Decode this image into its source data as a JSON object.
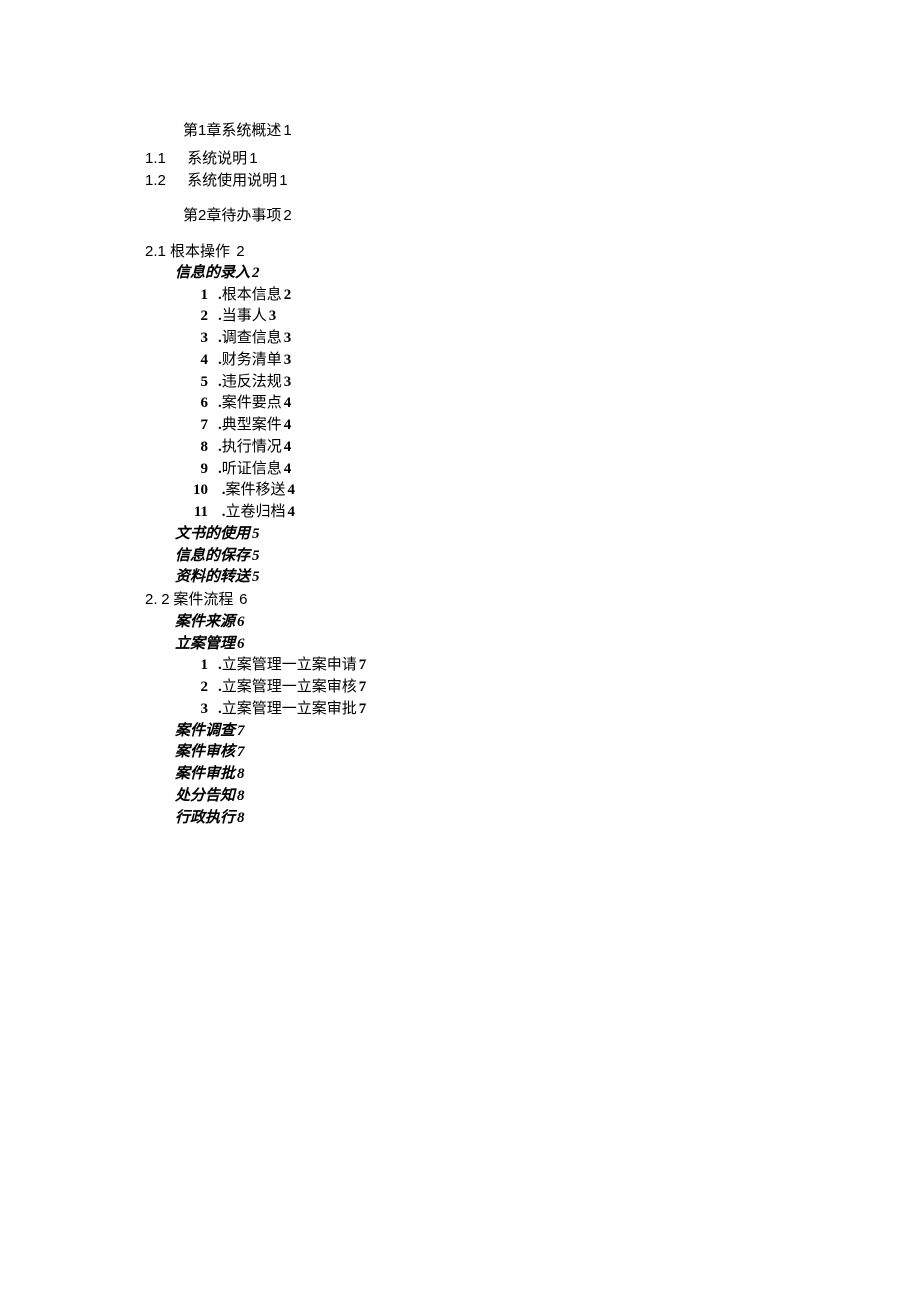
{
  "toc": {
    "ch1": {
      "title_pre": "第",
      "title_num": "1",
      "title_post": "章系统概述",
      "page": "1"
    },
    "s1_1": {
      "num": "1.1",
      "label": "系统说明",
      "page": "1"
    },
    "s1_2": {
      "num": "1.2",
      "label": "系统使用说明",
      "page": "1"
    },
    "ch2": {
      "title_pre": "第",
      "title_num": "2",
      "title_post": "章待办事项",
      "page": "2"
    },
    "s2_1": {
      "num": "2.1",
      "label": "根本操作",
      "page": "2"
    },
    "info_entry": {
      "label": "信息的录入",
      "page": "2"
    },
    "e1": {
      "n": "1",
      "label": "根本信息",
      "page": "2"
    },
    "e2": {
      "n": "2",
      "label": "当事人",
      "page": "3"
    },
    "e3": {
      "n": "3",
      "label": "调查信息",
      "page": "3"
    },
    "e4": {
      "n": "4",
      "label": "财务清单",
      "page": "3"
    },
    "e5": {
      "n": "5",
      "label": "违反法规",
      "page": "3"
    },
    "e6": {
      "n": "6",
      "label": "案件要点",
      "page": "4"
    },
    "e7": {
      "n": "7",
      "label": "典型案件",
      "page": "4"
    },
    "e8": {
      "n": "8",
      "label": "执行情况",
      "page": "4"
    },
    "e9": {
      "n": "9",
      "label": "听证信息",
      "page": "4"
    },
    "e10": {
      "n": "10",
      "label": "案件移送",
      "page": "4"
    },
    "e11": {
      "n": "11",
      "label": "立卷归档",
      "page": "4"
    },
    "doc_use": {
      "label": "文书的使用",
      "page": "5"
    },
    "info_save": {
      "label": "信息的保存",
      "page": "5"
    },
    "data_send": {
      "label": "资料的转送",
      "page": "5"
    },
    "s2_2": {
      "num_a": "2.",
      "num_b": "2",
      "label": "案件流程",
      "page": "6"
    },
    "case_src": {
      "label": "案件来源",
      "page": "6"
    },
    "case_mgmt": {
      "label": "立案管理",
      "page": "6"
    },
    "m1": {
      "n": "1",
      "label": "立案管理一立案申请",
      "page": "7"
    },
    "m2": {
      "n": "2",
      "label": "立案管理一立案审核",
      "page": "7"
    },
    "m3": {
      "n": "3",
      "label": "立案管理一立案审批",
      "page": "7"
    },
    "case_inv": {
      "label": "案件调查",
      "page": "7"
    },
    "case_review": {
      "label": "案件审核",
      "page": "7"
    },
    "case_approv": {
      "label": "案件审批",
      "page": "8"
    },
    "penalty": {
      "label": "处分告知",
      "page": "8"
    },
    "admin_exec": {
      "label": "行政执行",
      "page": "8"
    }
  }
}
